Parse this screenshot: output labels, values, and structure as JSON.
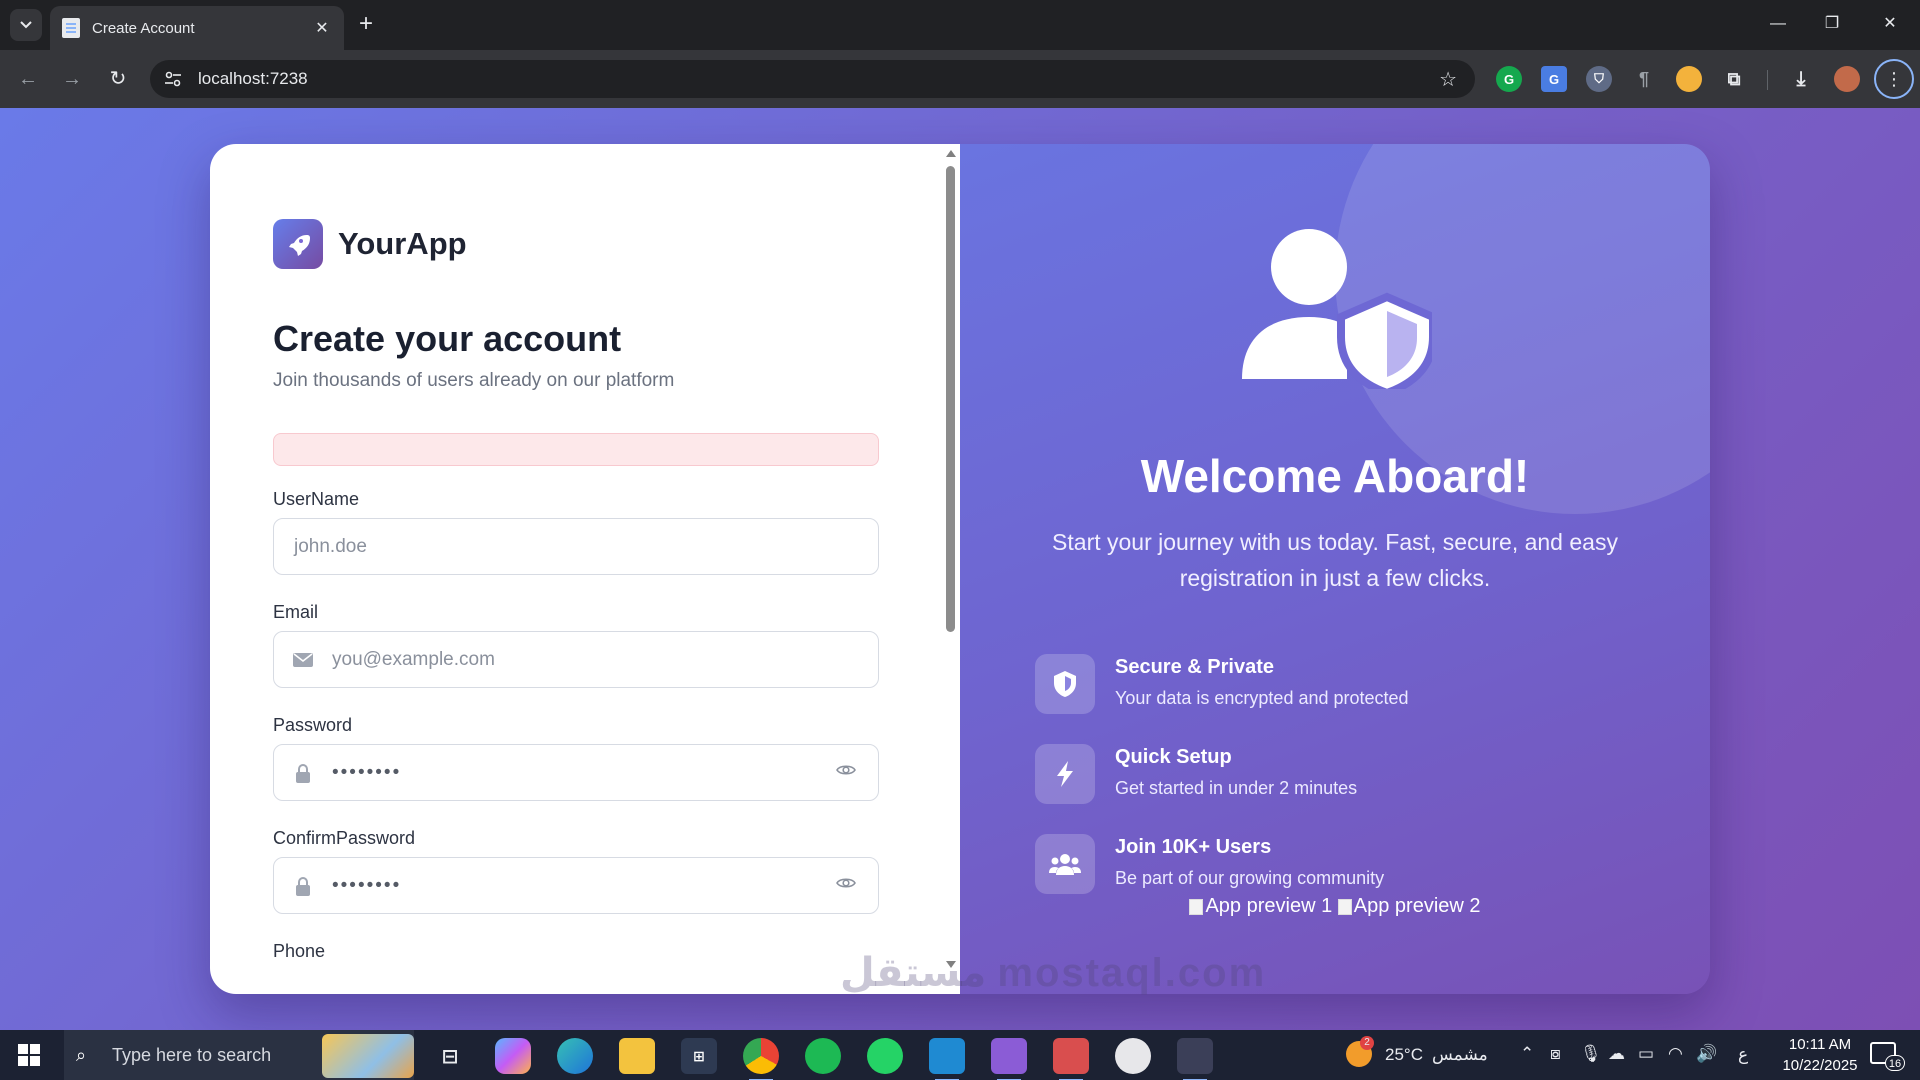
{
  "browser": {
    "tab_title": "Create Account",
    "url": "localhost:7238"
  },
  "page": {
    "brand": "YourApp",
    "heading": "Create your account",
    "subheading": "Join thousands of users already on our platform",
    "form": {
      "username": {
        "label": "UserName",
        "placeholder": "john.doe"
      },
      "email": {
        "label": "Email",
        "placeholder": "you@example.com"
      },
      "password": {
        "label": "Password",
        "value": "••••••••"
      },
      "confirm_password": {
        "label": "ConfirmPassword",
        "value": "••••••••"
      },
      "phone": {
        "label": "Phone"
      }
    },
    "hero": {
      "title": "Welcome Aboard!",
      "tagline": "Start your journey with us today. Fast, secure, and easy registration in just a few clicks.",
      "features": [
        {
          "title": "Secure & Private",
          "description": "Your data is encrypted and protected",
          "icon": "shield-icon"
        },
        {
          "title": "Quick Setup",
          "description": "Get started in under 2 minutes",
          "icon": "bolt-icon"
        },
        {
          "title": "Join 10K+ Users",
          "description": "Be part of our growing community",
          "icon": "users-icon"
        }
      ],
      "previews": [
        "App preview 1",
        "App preview 2"
      ]
    },
    "watermark": "مستقل mostaql.com"
  },
  "taskbar": {
    "search_placeholder": "Type here to search",
    "weather": "25°C",
    "weather_desc": "مشمس",
    "weather_badge": "2",
    "lang": "ع",
    "time": "10:11 AM",
    "date": "10/22/2025",
    "notifications": "16"
  },
  "colors": {
    "accent_gradient_start": "#667eea",
    "accent_gradient_end": "#764ba2",
    "alert_bg": "#fde8ea"
  }
}
